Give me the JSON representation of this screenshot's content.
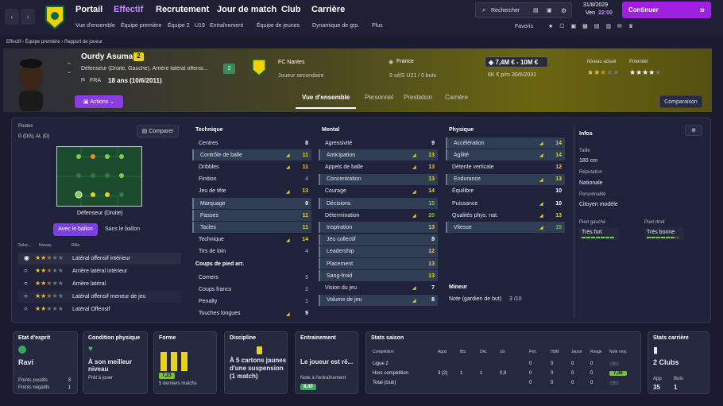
{
  "nav": {
    "items": [
      "Portail",
      "Effectif",
      "Recrutement",
      "Jour de match",
      "Club",
      "Carrière"
    ],
    "sub": [
      "Vue d'ensemble",
      "Équipe première",
      "Équipe 2",
      "U19",
      "Entraînement",
      "Équipe de jeunes",
      "Dynamique de grp.",
      "Plus"
    ],
    "search": "Rechercher",
    "date": "31/8/2029",
    "day": "Ven",
    "time": "22:00",
    "continue": "Continuer",
    "favorites": "Favoris"
  },
  "breadcrumb": [
    "Effectif",
    "Équipe première",
    "Rapport de joueur"
  ],
  "player": {
    "name": "Ourdy Asumani",
    "number": "2",
    "position": "Défenseur (Droite, Gauche), Arrière latéral offensi...",
    "nationality": "FRA",
    "age": "18 ans (10/6/2011)",
    "squad_number": "2",
    "club": "FC Nantes",
    "role": "Joueur secondaire",
    "country": "France",
    "caps": "9 sélS U21 / 0 buts",
    "value": "7,4M € - 10M €",
    "wage": "6K € p/m 30/6/2031",
    "level_label": "Niveau actuel",
    "potential_label": "Potentiel",
    "actions": "Actions",
    "compare_btn": "Comparaison"
  },
  "tabs": [
    "Vue d'ensemble",
    "Personnel",
    "Prestation",
    "Carrière"
  ],
  "positions": {
    "title": "Postes",
    "value": "D (DG), AL (D)",
    "compare": "Comparer",
    "label": "Défenseur (Droite)",
    "with_ball": "Avec le ballon",
    "without_ball": "Sans le ballon",
    "col_sel": "Sélec...",
    "col_level": "Niveau",
    "col_role": "Rôle",
    "roles": [
      {
        "name": "Latéral offensif intérieur",
        "stars": 2.5
      },
      {
        "name": "Arrière latéral intérieur",
        "stars": 2.5
      },
      {
        "name": "Arrière latéral",
        "stars": 2.5
      },
      {
        "name": "Latéral offensif meneur de jeu",
        "stars": 2.5
      },
      {
        "name": "Latéral Offensif",
        "stars": 2
      }
    ]
  },
  "technique": {
    "title": "Technique",
    "rows": [
      [
        "Centres",
        "8"
      ],
      [
        "Contrôle de balle",
        "11"
      ],
      [
        "Dribbles",
        "11"
      ],
      [
        "Finition",
        "4"
      ],
      [
        "Jeu de tête",
        "13"
      ],
      [
        "Marquage",
        "9"
      ],
      [
        "Passes",
        "11"
      ],
      [
        "Tacles",
        "11"
      ],
      [
        "Technique",
        "14"
      ],
      [
        "Tirs de loin",
        "4"
      ]
    ]
  },
  "setpieces": {
    "title": "Coups de pied arr.",
    "rows": [
      [
        "Corners",
        "5"
      ],
      [
        "Coups francs",
        "2"
      ],
      [
        "Penalty",
        "1"
      ],
      [
        "Touches longues",
        "9"
      ]
    ]
  },
  "mental": {
    "title": "Mental",
    "rows": [
      [
        "Agressivité",
        "9"
      ],
      [
        "Anticipation",
        "13"
      ],
      [
        "Appels de balle",
        "13"
      ],
      [
        "Concentration",
        "13"
      ],
      [
        "Courage",
        "14"
      ],
      [
        "Décisions",
        "15"
      ],
      [
        "Détermination",
        "20"
      ],
      [
        "Inspiration",
        "13"
      ],
      [
        "Jeu collectif",
        "8"
      ],
      [
        "Leadership",
        "12"
      ],
      [
        "Placement",
        "13"
      ],
      [
        "Sang-froid",
        "13"
      ],
      [
        "Vision du jeu",
        "7"
      ],
      [
        "Volume de jeu",
        "8"
      ]
    ]
  },
  "physique": {
    "title": "Physique",
    "rows": [
      [
        "Accélération",
        "14"
      ],
      [
        "Agilité",
        "14"
      ],
      [
        "Détente verticale",
        "12"
      ],
      [
        "Endurance",
        "13"
      ],
      [
        "Équilibre",
        "10"
      ],
      [
        "Puissance",
        "10"
      ],
      [
        "Qualités phys. nat.",
        "13"
      ],
      [
        "Vitesse",
        "15"
      ]
    ]
  },
  "goalkeeper": {
    "title": "Mineur",
    "label": "Note (gardien de but)",
    "value": "3 /10"
  },
  "info": {
    "title": "Infos",
    "height_label": "Taille",
    "height": "180 cm",
    "nat_label": "Réputation",
    "nat": "Nationale",
    "pers_label": "Personnalité",
    "pers": "Citoyen modèle",
    "lf_label": "Pied gauche",
    "lf": "Très fort",
    "rf_label": "Pied droit",
    "rf": "Très bonne"
  },
  "cards": {
    "morale": {
      "t": "Etat d'esprit",
      "v": "Ravi",
      "l1": "Points positifs",
      "n1": "3",
      "l2": "Points négatifs",
      "n2": "1"
    },
    "cond": {
      "t": "Condition physique",
      "v": "À son meilleur niveau",
      "s": "Prêt à jouer"
    },
    "form": {
      "t": "Forme",
      "v": "7,23",
      "s": "5 derniers matchs"
    },
    "disc": {
      "t": "Discipline",
      "v": "À 5 cartons jaunes d'une suspension (1 match)"
    },
    "train": {
      "t": "Entrainement",
      "v": "Le joueur est ré...",
      "s": "Note à l'entraînement",
      "n": "8,40"
    },
    "stats": {
      "t": "Stats saison",
      "cols": [
        "Compétition",
        "Apps",
        "Bts",
        "Déc",
        "xG",
        "Pen",
        "HdM",
        "Jaune",
        "Rouge",
        "Note moy."
      ],
      "rows": [
        [
          "Ligue 2",
          "",
          "",
          "",
          "",
          "0",
          "0",
          "0",
          "0",
          "-"
        ],
        [
          "Hors compétition",
          "3 (2)",
          "1",
          "1",
          "0,9",
          "0",
          "0",
          "0",
          "0",
          "7,36"
        ],
        [
          "Total (club)",
          "",
          "",
          "",
          "",
          "0",
          "0",
          "0",
          "0",
          "-"
        ]
      ]
    },
    "career": {
      "t": "Stats carrière",
      "v": "2 Clubs",
      "a": "App",
      "an": "35",
      "b": "Buts",
      "bn": "1"
    }
  }
}
